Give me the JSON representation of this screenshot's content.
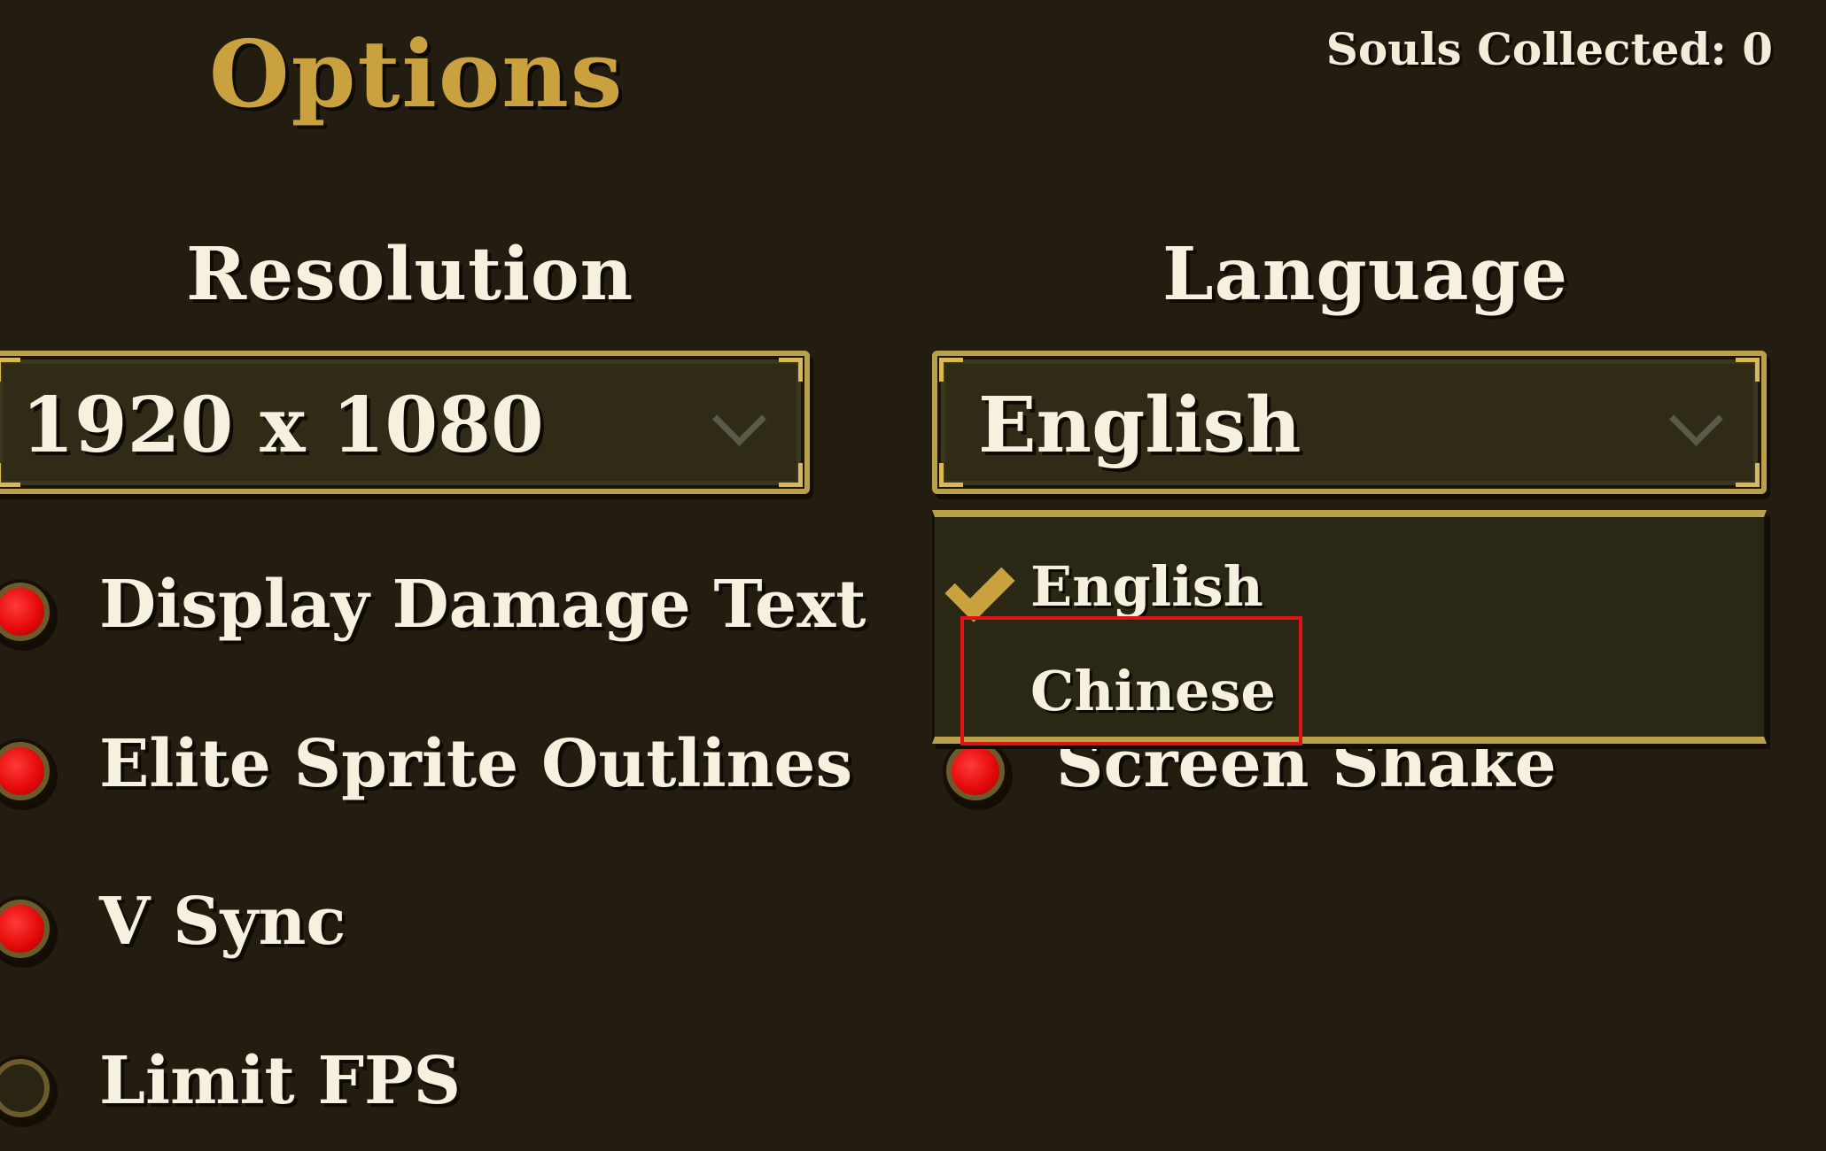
{
  "header": {
    "title": "Options",
    "souls_collected": "Souls Collected: 0"
  },
  "resolution": {
    "heading": "Resolution",
    "selected": "1920 x 1080"
  },
  "language": {
    "heading": "Language",
    "selected": "English",
    "options": [
      {
        "label": "English",
        "checked": true
      },
      {
        "label": "Chinese",
        "checked": false,
        "highlighted": true
      }
    ]
  },
  "toggles": {
    "display_damage_text": {
      "label": "Display Damage Text",
      "enabled": true
    },
    "elite_sprite_outlines": {
      "label": "Elite Sprite Outlines",
      "enabled": true
    },
    "v_sync": {
      "label": "V Sync",
      "enabled": true
    },
    "limit_fps": {
      "label": "Limit FPS",
      "enabled": false
    },
    "screen_shake": {
      "label": "Screen Shake",
      "enabled": true
    }
  },
  "colors": {
    "background": "#231d11",
    "title_gold": "#c9a23f",
    "frame_gold": "#bba04a",
    "toggle_on_red": "#e60a0a",
    "highlight_red": "#e01313"
  }
}
